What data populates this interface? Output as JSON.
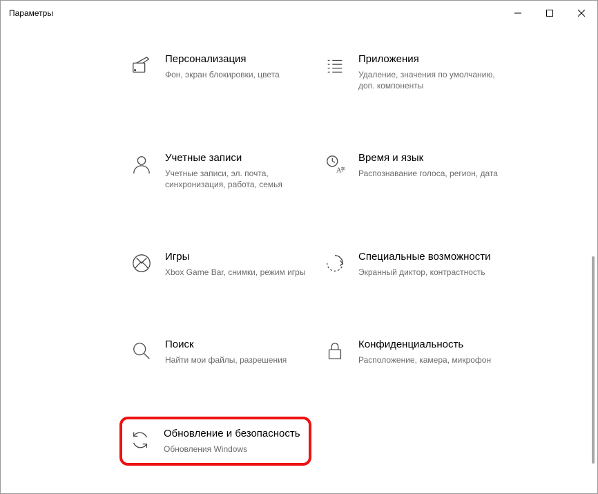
{
  "window": {
    "title": "Параметры"
  },
  "tiles": [
    {
      "title": "Персонализация",
      "desc": "Фон, экран блокировки, цвета"
    },
    {
      "title": "Приложения",
      "desc": "Удаление, значения по умолчанию, доп. компоненты"
    },
    {
      "title": "Учетные записи",
      "desc": "Учетные записи, эл. почта, синхронизация, работа, семья"
    },
    {
      "title": "Время и язык",
      "desc": "Распознавание голоса, регион, дата"
    },
    {
      "title": "Игры",
      "desc": "Xbox Game Bar, снимки, режим игры"
    },
    {
      "title": "Специальные возможности",
      "desc": "Экранный диктор, контрастность"
    },
    {
      "title": "Поиск",
      "desc": "Найти мои файлы, разрешения"
    },
    {
      "title": "Конфиденциальность",
      "desc": "Расположение, камера, микрофон"
    },
    {
      "title": "Обновление и безопасность",
      "desc": "Обновления Windows"
    }
  ]
}
